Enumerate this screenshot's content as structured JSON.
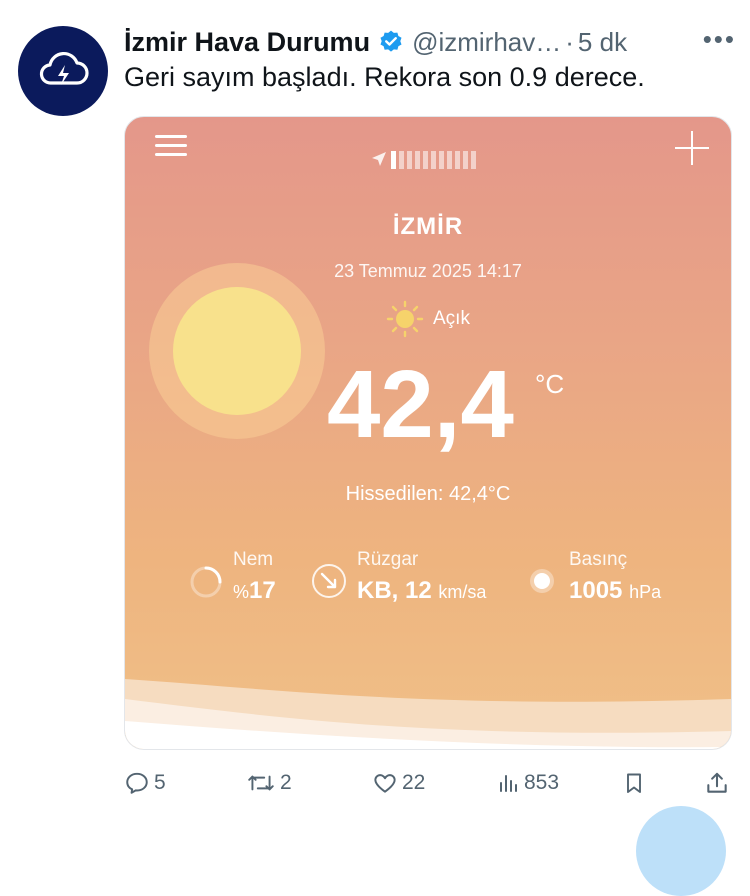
{
  "tweet": {
    "author_name": "İzmir Hava Durumu",
    "handle": "@izmirhav…",
    "separator": "·",
    "time": "5 dk",
    "more": "•••",
    "text": "Geri sayım başladı. Rekora son 0.9 derece."
  },
  "weather_card": {
    "city": "İZMİR",
    "datetime": "23 Temmuz 2025 14:17",
    "condition": "Açık",
    "temperature": "42,4",
    "temperature_unit": "°C",
    "feels_like": "Hissedilen: 42,4°C",
    "stats": {
      "humidity_label": "Nem",
      "humidity_prefix": "%",
      "humidity_value": "17",
      "wind_label": "Rüzgar",
      "wind_value": "KB, 12",
      "wind_unit": "km/sa",
      "pressure_label": "Basınç",
      "pressure_value": "1005",
      "pressure_unit": "hPa"
    }
  },
  "actions": {
    "replies": "5",
    "retweets": "2",
    "likes": "22",
    "views": "853"
  },
  "colors": {
    "avatar_bg": "#0b1a5c",
    "verified": "#1d9bf0",
    "muted_text": "#536471"
  }
}
